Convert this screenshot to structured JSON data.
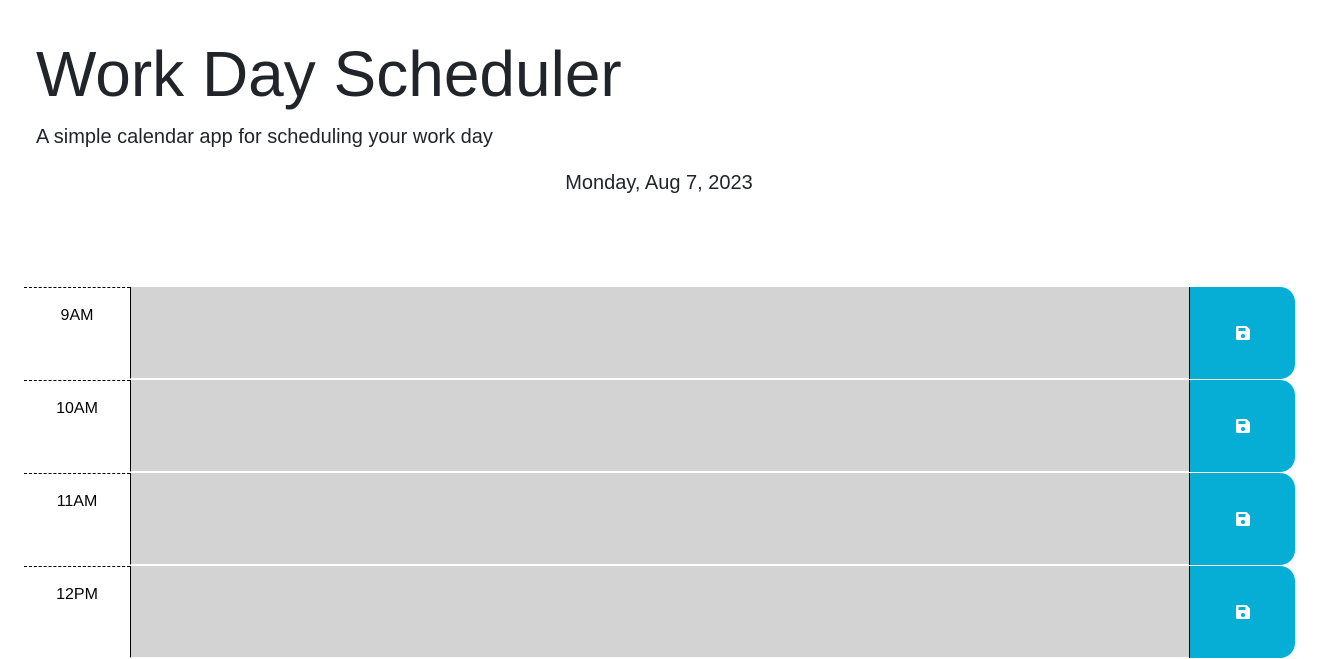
{
  "header": {
    "title": "Work Day Scheduler",
    "subtitle": "A simple calendar app for scheduling your work day",
    "current_day": "Monday, Aug 7, 2023"
  },
  "time_blocks": [
    {
      "hour": "9AM",
      "description": "",
      "save_icon": "save-icon"
    },
    {
      "hour": "10AM",
      "description": "",
      "save_icon": "save-icon"
    },
    {
      "hour": "11AM",
      "description": "",
      "save_icon": "save-icon"
    },
    {
      "hour": "12PM",
      "description": "",
      "save_icon": "save-icon"
    }
  ],
  "colors": {
    "past_block": "#d3d3d3",
    "save_button": "#06aed5",
    "text": "#212529"
  }
}
